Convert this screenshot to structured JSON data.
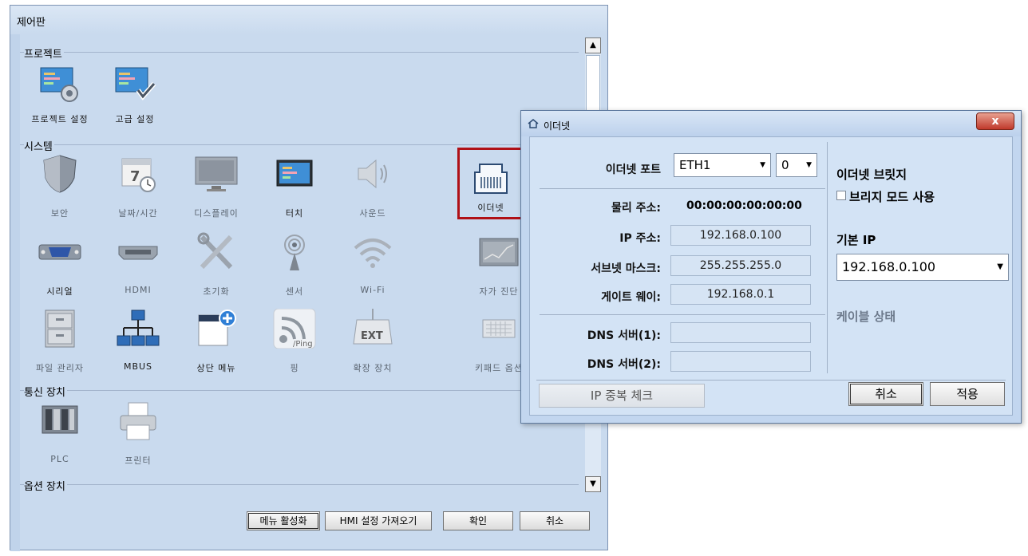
{
  "control_panel": {
    "title": "제어판",
    "sections": {
      "project": "프로젝트",
      "system": "시스템",
      "comm": "통신 장치",
      "option": "옵션 장치"
    },
    "project_items": [
      "프로젝트 설정",
      "고급 설정"
    ],
    "system_items": [
      "보안",
      "날짜/시간",
      "디스플레이",
      "터치",
      "사운드",
      "이더넷",
      "시리얼",
      "HDMI",
      "초기화",
      "센서",
      "Wi-Fi",
      "자가 진단",
      "파일 관리자",
      "MBUS",
      "상단 메뉴",
      "핑",
      "확장 장치",
      "키패드 옵션"
    ],
    "comm_items": [
      "PLC",
      "프린터"
    ],
    "icon_texts": {
      "calendar": "7",
      "ping": "/Ping",
      "ext": "EXT"
    },
    "buttons": {
      "menu_activate": "메뉴 활성화",
      "hmi_import": "HMI 설정 가져오기",
      "ok": "확인",
      "cancel": "취소"
    }
  },
  "ethernet_dialog": {
    "title": "이더넷",
    "close": "x",
    "port_label": "이더넷 포트",
    "port_value": "ETH1",
    "port_index": "0",
    "mac_label": "물리 주소:",
    "mac_value": "00:00:00:00:00:00",
    "ip_label": "IP 주소:",
    "ip_value": "192.168.0.100",
    "mask_label": "서브넷 마스크:",
    "mask_value": "255.255.255.0",
    "gw_label": "게이트 웨이:",
    "gw_value": "192.168.0.1",
    "dns1_label": "DNS 서버(1):",
    "dns1_value": "",
    "dns2_label": "DNS 서버(2):",
    "dns2_value": "",
    "bridge_title": "이더넷 브릿지",
    "bridge_checkbox": "브리지 모드 사용",
    "default_ip_label": "기본 IP",
    "default_ip_value": "192.168.0.100",
    "cable_status": "케이블 상태",
    "ip_dup_check": "IP 중복 체크",
    "cancel": "취소",
    "apply": "적용"
  },
  "colors": {
    "selection": "#b01016",
    "panel_bg": "#c9daee",
    "dialog_bg": "#d3e3f5"
  }
}
